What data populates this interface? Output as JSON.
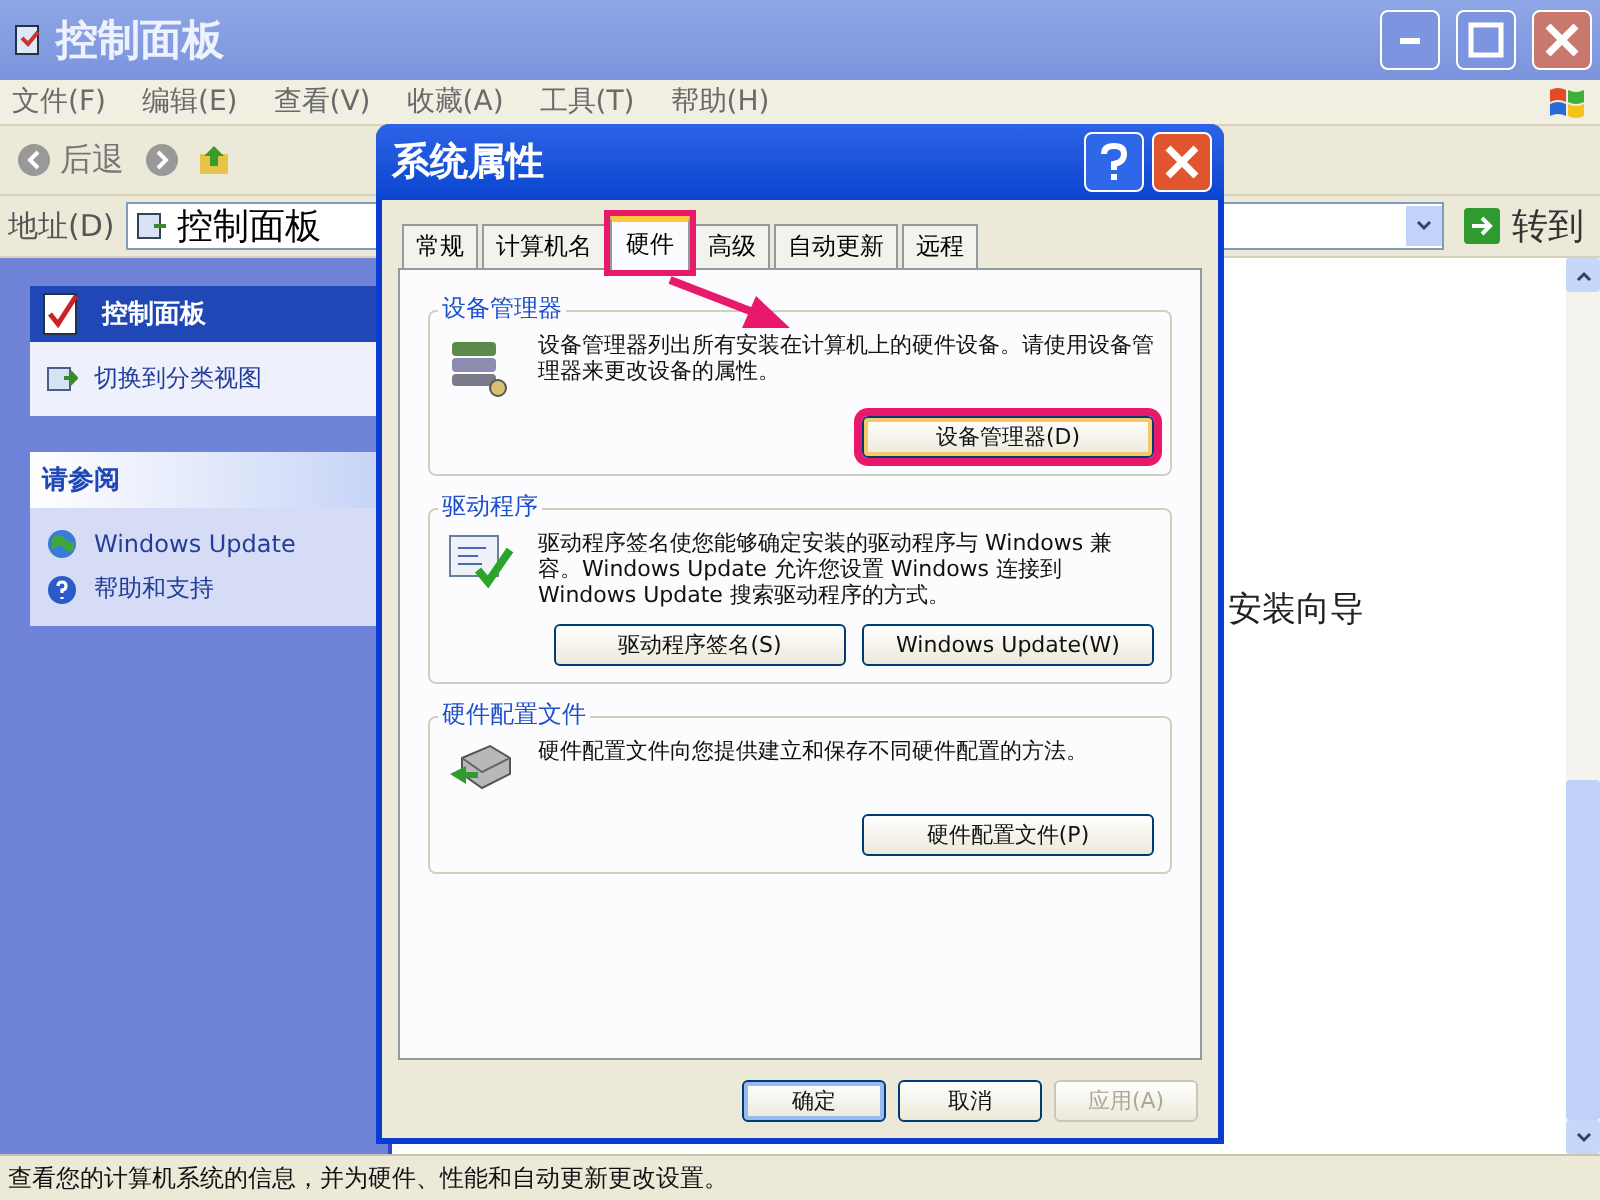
{
  "window": {
    "title": "控制面板"
  },
  "menu": [
    "文件(F)",
    "编辑(E)",
    "查看(V)",
    "收藏(A)",
    "工具(T)",
    "帮助(H)"
  ],
  "toolbar": {
    "back": "后退"
  },
  "address": {
    "label": "地址(D)",
    "value": "控制面板",
    "go": "转到"
  },
  "sidebar": [
    {
      "title": "控制面板",
      "kind": "primary",
      "items": [
        {
          "label": "切换到分类视图"
        }
      ]
    },
    {
      "title": "请参阅",
      "kind": "secondary",
      "items": [
        {
          "label": "Windows Update"
        },
        {
          "label": "帮助和支持"
        }
      ]
    }
  ],
  "content": {
    "visible_text": "安装向导"
  },
  "status_bar": "查看您的计算机系统的信息，并为硬件、性能和自动更新更改设置。",
  "dialog": {
    "title": "系统属性",
    "tabs": [
      {
        "label": "常规",
        "selected": false,
        "highlighted": false
      },
      {
        "label": "计算机名",
        "selected": false,
        "highlighted": false
      },
      {
        "label": "硬件",
        "selected": true,
        "highlighted": true
      },
      {
        "label": "高级",
        "selected": false,
        "highlighted": false
      },
      {
        "label": "自动更新",
        "selected": false,
        "highlighted": false
      },
      {
        "label": "远程",
        "selected": false,
        "highlighted": false
      }
    ],
    "groups": [
      {
        "title": "设备管理器",
        "text": "设备管理器列出所有安装在计算机上的硬件设备。请使用设备管理器来更改设备的属性。",
        "buttons": [
          {
            "label": "设备管理器(D)",
            "highlighted": true
          }
        ]
      },
      {
        "title": "驱动程序",
        "text": "驱动程序签名使您能够确定安装的驱动程序与 Windows 兼容。Windows Update 允许您设置 Windows 连接到 Windows Update 搜索驱动程序的方式。",
        "buttons": [
          {
            "label": "驱动程序签名(S)",
            "highlighted": false
          },
          {
            "label": "Windows Update(W)",
            "highlighted": false
          }
        ]
      },
      {
        "title": "硬件配置文件",
        "text": "硬件配置文件向您提供建立和保存不同硬件配置的方法。",
        "buttons": [
          {
            "label": "硬件配置文件(P)",
            "highlighted": false
          }
        ]
      }
    ],
    "buttons": [
      {
        "label": "确定",
        "disabled": false,
        "default": true
      },
      {
        "label": "取消",
        "disabled": false,
        "default": false
      },
      {
        "label": "应用(A)",
        "disabled": true,
        "default": false
      }
    ]
  }
}
